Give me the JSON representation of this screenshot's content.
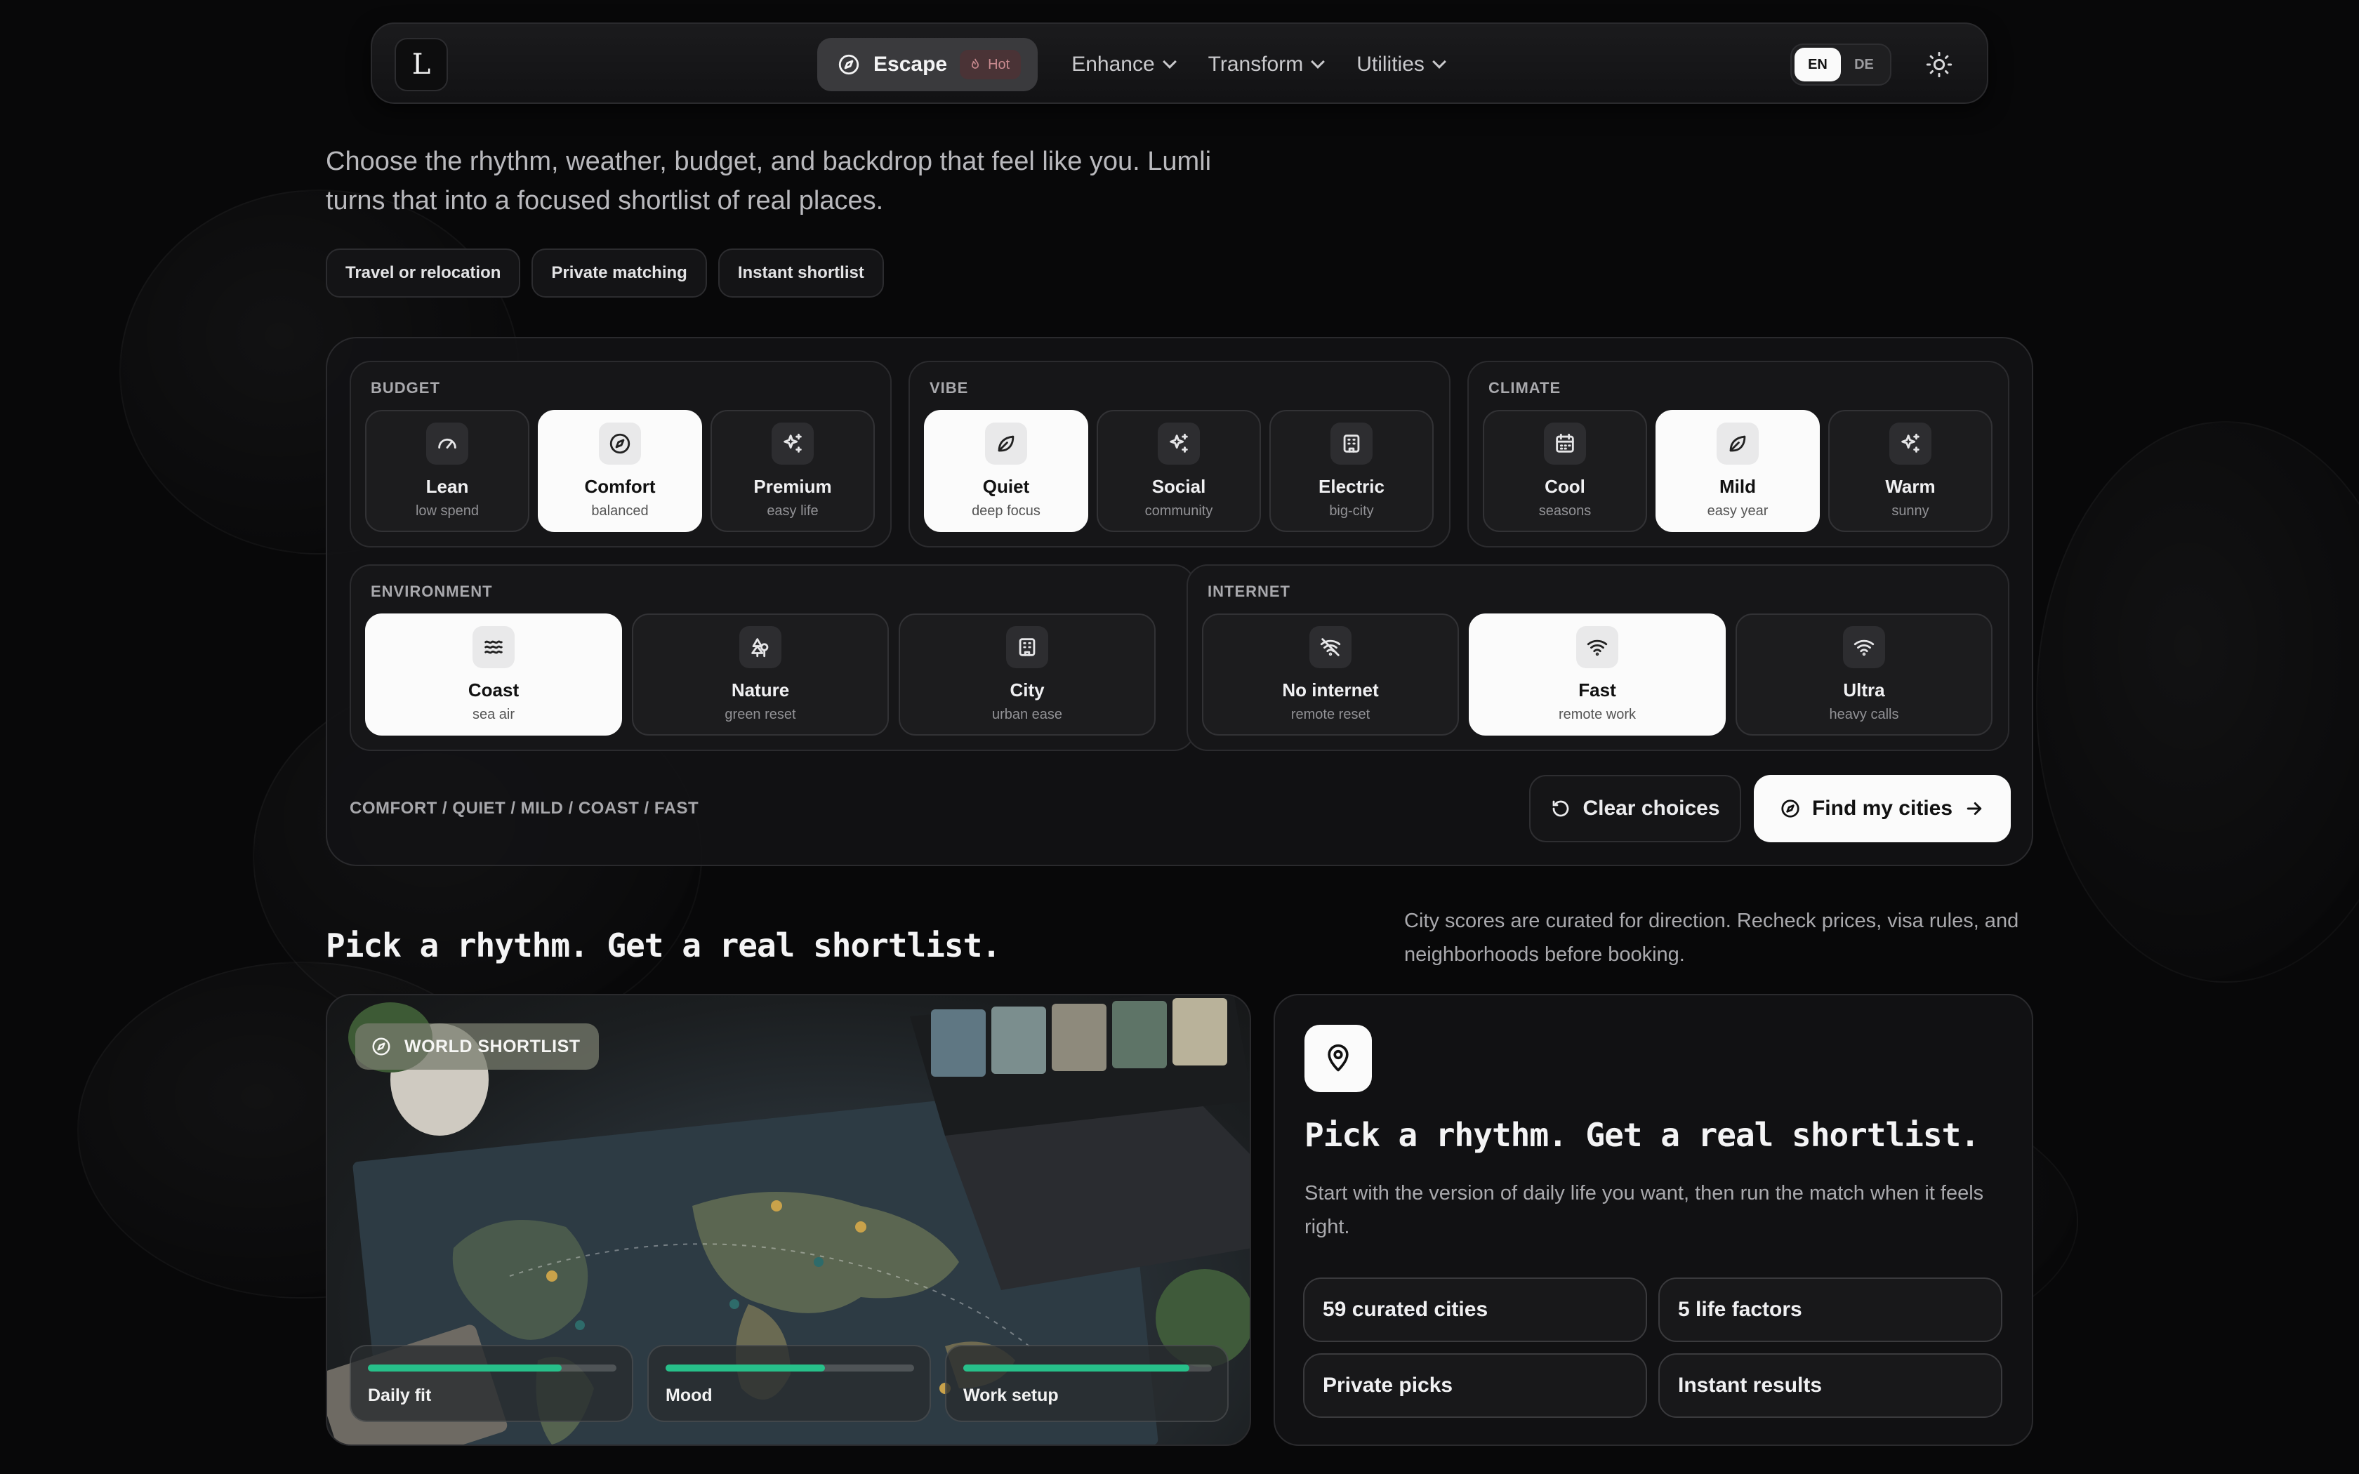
{
  "nav": {
    "logo": "L",
    "active_item": "Escape",
    "hot_badge": "Hot",
    "items": [
      {
        "label": "Enhance"
      },
      {
        "label": "Transform"
      },
      {
        "label": "Utilities"
      }
    ],
    "languages": [
      "EN",
      "DE"
    ],
    "selected_language": "EN"
  },
  "hero": {
    "intro": "Choose the rhythm, weather, budget, and backdrop that feel like you. Lumli turns that into a focused shortlist of real places.",
    "chips": [
      "Travel or relocation",
      "Private matching",
      "Instant shortlist"
    ]
  },
  "groups": {
    "budget": {
      "title": "BUDGET",
      "options": [
        {
          "label": "Lean",
          "sub": "low spend",
          "icon": "gauge-icon",
          "selected": false
        },
        {
          "label": "Comfort",
          "sub": "balanced",
          "icon": "compass-icon",
          "selected": true
        },
        {
          "label": "Premium",
          "sub": "easy life",
          "icon": "sparkles-icon",
          "selected": false
        }
      ]
    },
    "vibe": {
      "title": "VIBE",
      "options": [
        {
          "label": "Quiet",
          "sub": "deep focus",
          "icon": "leaf-icon",
          "selected": true
        },
        {
          "label": "Social",
          "sub": "community",
          "icon": "sparkles-icon",
          "selected": false
        },
        {
          "label": "Electric",
          "sub": "big-city",
          "icon": "building-icon",
          "selected": false
        }
      ]
    },
    "climate": {
      "title": "CLIMATE",
      "options": [
        {
          "label": "Cool",
          "sub": "seasons",
          "icon": "calendar-icon",
          "selected": false
        },
        {
          "label": "Mild",
          "sub": "easy year",
          "icon": "leaf-icon",
          "selected": true
        },
        {
          "label": "Warm",
          "sub": "sunny",
          "icon": "sparkles-icon",
          "selected": false
        }
      ]
    },
    "environment": {
      "title": "ENVIRONMENT",
      "options": [
        {
          "label": "Coast",
          "sub": "sea air",
          "icon": "waves-icon",
          "selected": true
        },
        {
          "label": "Nature",
          "sub": "green reset",
          "icon": "trees-icon",
          "selected": false
        },
        {
          "label": "City",
          "sub": "urban ease",
          "icon": "building-icon",
          "selected": false
        }
      ]
    },
    "internet": {
      "title": "INTERNET",
      "options": [
        {
          "label": "No internet",
          "sub": "remote reset",
          "icon": "wifi-off-icon",
          "selected": false
        },
        {
          "label": "Fast",
          "sub": "remote work",
          "icon": "wifi-icon",
          "selected": true
        },
        {
          "label": "Ultra",
          "sub": "heavy calls",
          "icon": "wifi-icon",
          "selected": false
        }
      ]
    }
  },
  "summary": "COMFORT / QUIET / MILD / COAST / FAST",
  "actions": {
    "clear": "Clear choices",
    "find": "Find my cities"
  },
  "section": {
    "title": "Pick a rhythm. Get a real shortlist.",
    "note": "City scores are curated for direction. Recheck prices, visa rules, and neighborhoods before booking."
  },
  "photo": {
    "badge": "WORLD SHORTLIST",
    "metrics": [
      {
        "label": "Daily fit",
        "level": 0.78
      },
      {
        "label": "Mood",
        "level": 0.64
      },
      {
        "label": "Work setup",
        "level": 0.91
      }
    ]
  },
  "card": {
    "title": "Pick a rhythm. Get a real shortlist.",
    "body": "Start with the version of daily life you want, then run the match when it feels right.",
    "stats": [
      "59 curated cities",
      "5 life factors",
      "Private picks",
      "Instant results"
    ]
  },
  "colors": {
    "accent": "#27c08a",
    "selected_bg": "#fbfbfb",
    "hot": "#c98a8f"
  }
}
